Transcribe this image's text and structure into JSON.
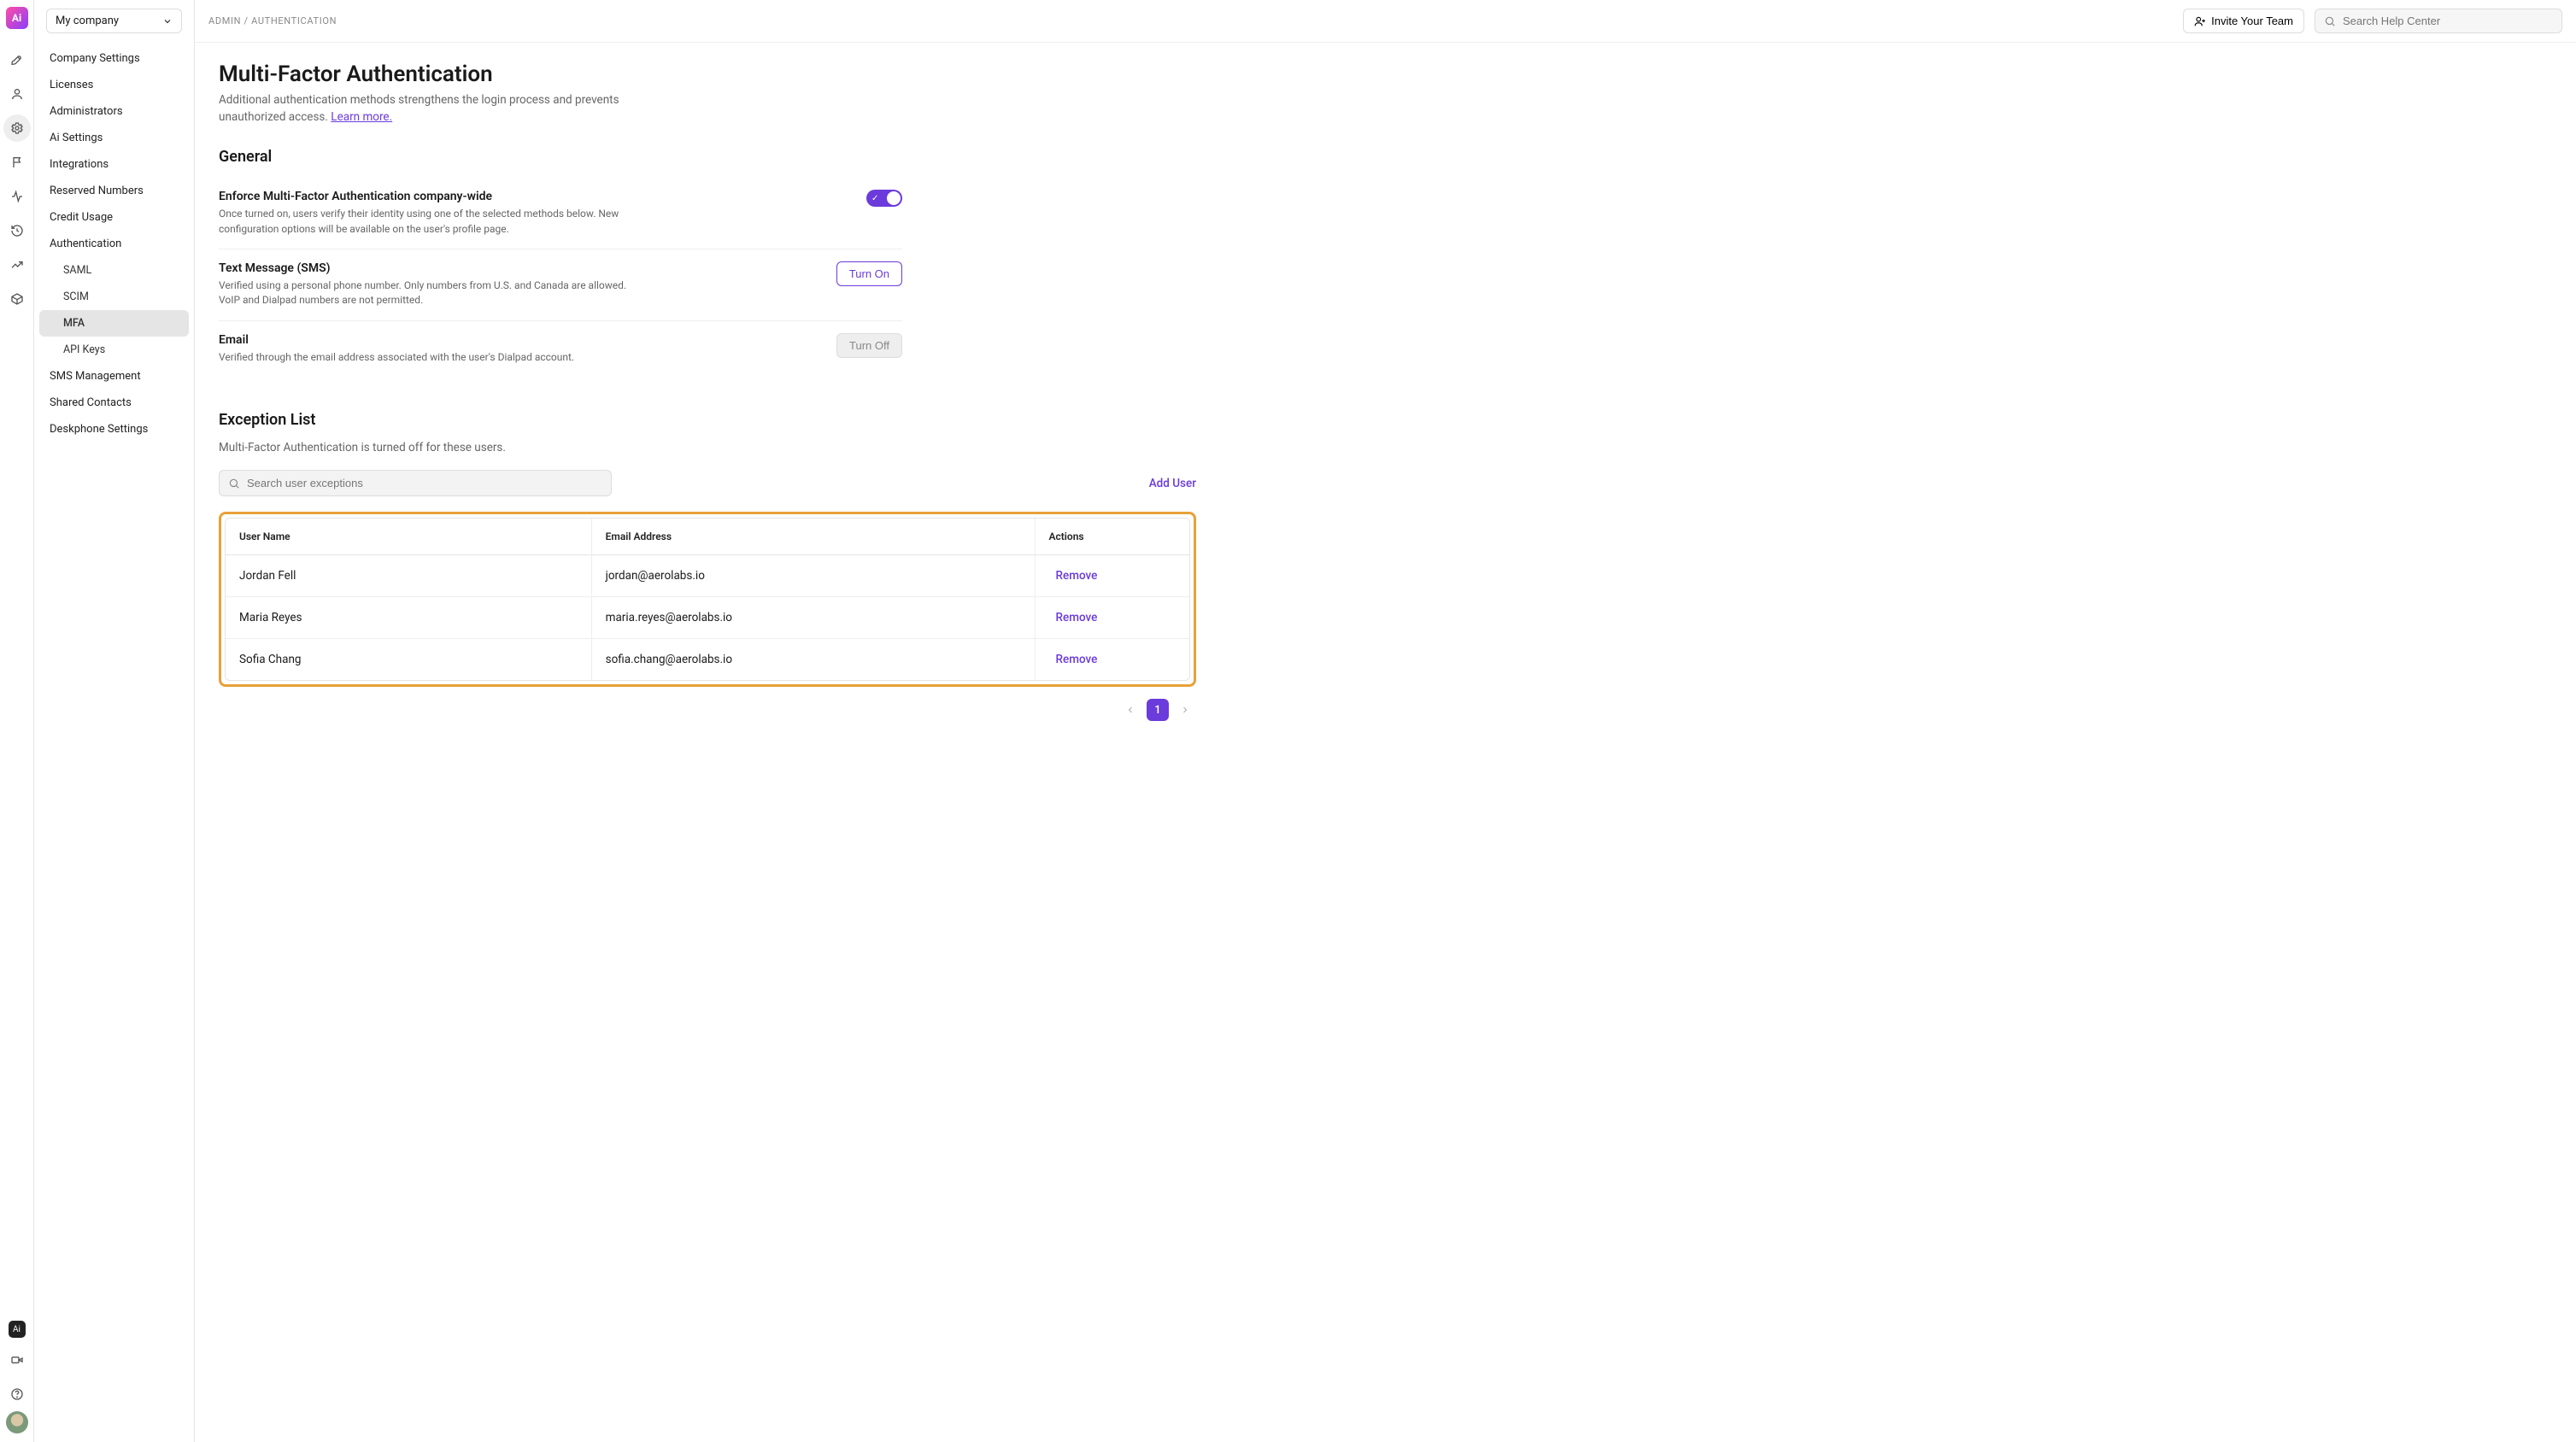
{
  "company_selector": {
    "label": "My company"
  },
  "breadcrumb": "ADMIN / AUTHENTICATION",
  "invite_label": "Invite Your Team",
  "search_help_placeholder": "Search Help Center",
  "sidebar": {
    "items": [
      {
        "label": "Company Settings"
      },
      {
        "label": "Licenses"
      },
      {
        "label": "Administrators"
      },
      {
        "label": "Ai Settings"
      },
      {
        "label": "Integrations"
      },
      {
        "label": "Reserved Numbers"
      },
      {
        "label": "Credit Usage"
      },
      {
        "label": "Authentication"
      },
      {
        "label": "SMS Management"
      },
      {
        "label": "Shared Contacts"
      },
      {
        "label": "Deskphone Settings"
      }
    ],
    "auth_sub": [
      {
        "label": "SAML"
      },
      {
        "label": "SCIM"
      },
      {
        "label": "MFA"
      },
      {
        "label": "API Keys"
      }
    ]
  },
  "page": {
    "title": "Multi-Factor Authentication",
    "subtitle": "Additional authentication methods strengthens the login process and prevents unauthorized access. ",
    "learn_more": "Learn more."
  },
  "general": {
    "heading": "General",
    "enforce": {
      "title": "Enforce Multi-Factor Authentication company-wide",
      "desc": "Once turned on, users verify their identity using one of the selected methods below. New configuration options will be available on the user's profile page."
    },
    "sms": {
      "title": "Text Message (SMS)",
      "desc": "Verified using a personal phone number. Only numbers from U.S. and Canada are allowed. VoIP and Dialpad numbers are not permitted.",
      "button": "Turn On"
    },
    "email": {
      "title": "Email",
      "desc": "Verified through the email address associated with the user's Dialpad account.",
      "button": "Turn Off"
    }
  },
  "exception": {
    "heading": "Exception List",
    "desc": "Multi-Factor Authentication is turned off for these users.",
    "search_placeholder": "Search user exceptions",
    "add_user": "Add User",
    "columns": {
      "name": "User Name",
      "email": "Email Address",
      "actions": "Actions"
    },
    "rows": [
      {
        "name": "Jordan Fell",
        "email": "jordan@aerolabs.io",
        "action": "Remove"
      },
      {
        "name": "Maria Reyes",
        "email": "maria.reyes@aerolabs.io",
        "action": "Remove"
      },
      {
        "name": "Sofia Chang",
        "email": "sofia.chang@aerolabs.io",
        "action": "Remove"
      }
    ]
  },
  "pager": {
    "current": "1"
  }
}
